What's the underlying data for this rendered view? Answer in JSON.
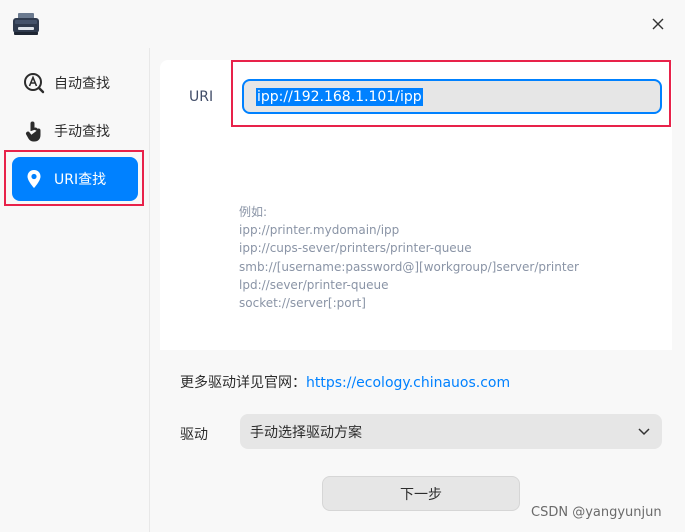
{
  "titlebar": {
    "app_icon": "printer-icon",
    "close_icon": "close-icon"
  },
  "sidebar": {
    "items": [
      {
        "label": "自动查找",
        "icon": "auto-search-icon",
        "active": false
      },
      {
        "label": "手动查找",
        "icon": "hand-pointer-icon",
        "active": false
      },
      {
        "label": "URI查找",
        "icon": "location-pin-icon",
        "active": true
      }
    ]
  },
  "uri": {
    "label": "URI",
    "value": "ipp://192.168.1.101/ipp"
  },
  "examples": {
    "heading": "例如:",
    "lines": [
      "ipp://printer.mydomain/ipp",
      "ipp://cups-sever/printers/printer-queue",
      "smb://[username:password@][workgroup/]server/printer",
      "lpd://sever/printer-queue",
      "socket://server[:port]"
    ]
  },
  "official": {
    "prefix": "更多驱动详见官网：",
    "link": "https://ecology.chinauos.com"
  },
  "driver": {
    "label": "驱动",
    "selected": "手动选择驱动方案"
  },
  "next_button": "下一步",
  "watermark": "CSDN @yangyunjun",
  "colors": {
    "accent": "#0081ff",
    "highlight": "#e8224a"
  }
}
